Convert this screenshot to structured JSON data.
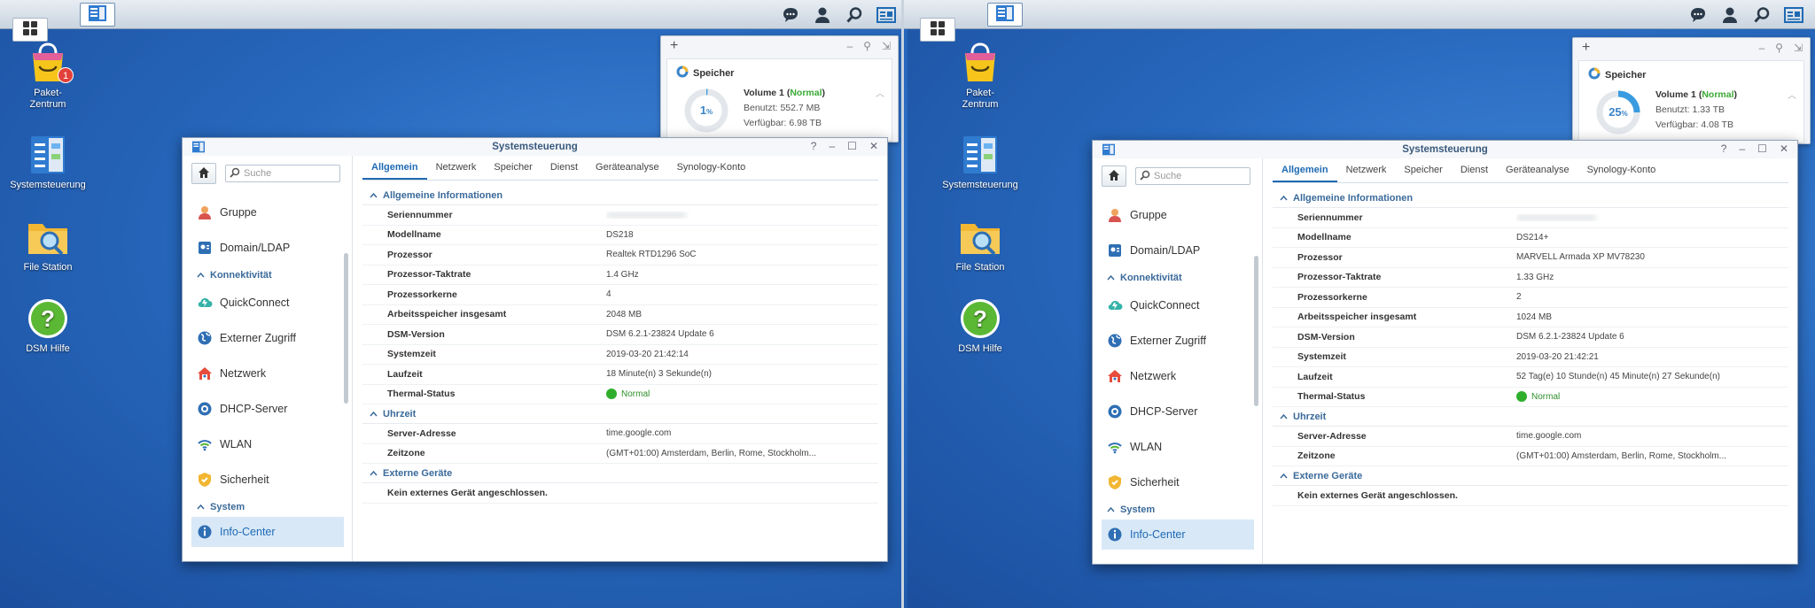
{
  "colors": {
    "accent": "#1f6ab4",
    "ok_green": "#2fae2c",
    "section_blue": "#3a6a9a",
    "desktop_blue": "#2768bd"
  },
  "desktop_icons": [
    {
      "label": "Paket-\nZentrum",
      "badge": "1",
      "icon": "package-center-icon"
    },
    {
      "label": "Systemsteuerung",
      "icon": "control-panel-icon"
    },
    {
      "label": "File Station",
      "icon": "file-station-icon"
    },
    {
      "label": "DSM Hilfe",
      "icon": "help-icon"
    }
  ],
  "taskbar": {
    "icons": [
      "chat-icon",
      "user-icon",
      "search-icon",
      "widgets-icon"
    ]
  },
  "left": {
    "widget": {
      "plus": "+",
      "title": "Speicher",
      "percent": "1",
      "percent_unit": "%",
      "percent_value": 1,
      "volume_name": "Volume 1 (",
      "volume_status": "Normal",
      "volume_close": ")",
      "used": "Benutzt: 552.7 MB",
      "free": "Verfügbar: 6.98 TB"
    },
    "window": {
      "title": "Systemsteuerung",
      "search_placeholder": "Suche",
      "nav": [
        {
          "type": "item",
          "label": "Gruppe",
          "icon": "group-icon"
        },
        {
          "type": "item",
          "label": "Domain/LDAP",
          "icon": "domain-icon"
        },
        {
          "type": "section",
          "label": "Konnektivität"
        },
        {
          "type": "item",
          "label": "QuickConnect",
          "icon": "quickconnect-icon"
        },
        {
          "type": "item",
          "label": "Externer Zugriff",
          "icon": "globe-icon"
        },
        {
          "type": "item",
          "label": "Netzwerk",
          "icon": "network-icon"
        },
        {
          "type": "item",
          "label": "DHCP-Server",
          "icon": "dhcp-icon"
        },
        {
          "type": "item",
          "label": "WLAN",
          "icon": "wifi-icon"
        },
        {
          "type": "item",
          "label": "Sicherheit",
          "icon": "shield-icon"
        },
        {
          "type": "section",
          "label": "System"
        },
        {
          "type": "item",
          "label": "Info-Center",
          "icon": "info-icon",
          "active": true
        }
      ],
      "tabs": [
        "Allgemein",
        "Netzwerk",
        "Speicher",
        "Dienst",
        "Geräteanalyse",
        "Synology-Konto"
      ],
      "sections": [
        {
          "title": "Allgemeine Informationen",
          "rows": [
            {
              "k": "Seriennummer",
              "v": "",
              "hidden": true
            },
            {
              "k": "Modellname",
              "v": "DS218"
            },
            {
              "k": "Prozessor",
              "v": "Realtek RTD1296 SoC"
            },
            {
              "k": "Prozessor-Taktrate",
              "v": "1.4 GHz"
            },
            {
              "k": "Prozessorkerne",
              "v": "4"
            },
            {
              "k": "Arbeitsspeicher insgesamt",
              "v": "2048 MB"
            },
            {
              "k": "DSM-Version",
              "v": "DSM 6.2.1-23824 Update 6"
            },
            {
              "k": "Systemzeit",
              "v": "2019-03-20 21:42:14"
            },
            {
              "k": "Laufzeit",
              "v": "18 Minute(n) 3 Sekunde(n)"
            },
            {
              "k": "Thermal-Status",
              "v": "Normal",
              "status": true
            }
          ]
        },
        {
          "title": "Uhrzeit",
          "rows": [
            {
              "k": "Server-Adresse",
              "v": "time.google.com"
            },
            {
              "k": "Zeitzone",
              "v": "(GMT+01:00) Amsterdam, Berlin, Rome, Stockholm..."
            }
          ]
        },
        {
          "title": "Externe Geräte",
          "rows": [
            {
              "k": "Kein externes Gerät angeschlossen.",
              "v": "",
              "full": true
            }
          ]
        }
      ]
    }
  },
  "right": {
    "widget": {
      "plus": "+",
      "title": "Speicher",
      "percent": "25",
      "percent_unit": "%",
      "percent_value": 25,
      "volume_name": "Volume 1 (",
      "volume_status": "Normal",
      "volume_close": ")",
      "used": "Benutzt: 1.33 TB",
      "free": "Verfügbar: 4.08 TB"
    },
    "window": {
      "title": "Systemsteuerung",
      "search_placeholder": "Suche",
      "nav": [
        {
          "type": "item",
          "label": "Gruppe",
          "icon": "group-icon"
        },
        {
          "type": "item",
          "label": "Domain/LDAP",
          "icon": "domain-icon"
        },
        {
          "type": "section",
          "label": "Konnektivität"
        },
        {
          "type": "item",
          "label": "QuickConnect",
          "icon": "quickconnect-icon"
        },
        {
          "type": "item",
          "label": "Externer Zugriff",
          "icon": "globe-icon"
        },
        {
          "type": "item",
          "label": "Netzwerk",
          "icon": "network-icon"
        },
        {
          "type": "item",
          "label": "DHCP-Server",
          "icon": "dhcp-icon"
        },
        {
          "type": "item",
          "label": "WLAN",
          "icon": "wifi-icon"
        },
        {
          "type": "item",
          "label": "Sicherheit",
          "icon": "shield-icon"
        },
        {
          "type": "section",
          "label": "System"
        },
        {
          "type": "item",
          "label": "Info-Center",
          "icon": "info-icon",
          "active": true
        }
      ],
      "tabs": [
        "Allgemein",
        "Netzwerk",
        "Speicher",
        "Dienst",
        "Geräteanalyse",
        "Synology-Konto"
      ],
      "sections": [
        {
          "title": "Allgemeine Informationen",
          "rows": [
            {
              "k": "Seriennummer",
              "v": "",
              "hidden": true
            },
            {
              "k": "Modellname",
              "v": "DS214+"
            },
            {
              "k": "Prozessor",
              "v": "MARVELL Armada XP MV78230"
            },
            {
              "k": "Prozessor-Taktrate",
              "v": "1.33 GHz"
            },
            {
              "k": "Prozessorkerne",
              "v": "2"
            },
            {
              "k": "Arbeitsspeicher insgesamt",
              "v": "1024 MB"
            },
            {
              "k": "DSM-Version",
              "v": "DSM 6.2.1-23824 Update 6"
            },
            {
              "k": "Systemzeit",
              "v": "2019-03-20 21:42:21"
            },
            {
              "k": "Laufzeit",
              "v": "52 Tag(e) 10 Stunde(n) 45 Minute(n) 27 Sekunde(n)"
            },
            {
              "k": "Thermal-Status",
              "v": "Normal",
              "status": true
            }
          ]
        },
        {
          "title": "Uhrzeit",
          "rows": [
            {
              "k": "Server-Adresse",
              "v": "time.google.com"
            },
            {
              "k": "Zeitzone",
              "v": "(GMT+01:00) Amsterdam, Berlin, Rome, Stockholm..."
            }
          ]
        },
        {
          "title": "Externe Geräte",
          "rows": [
            {
              "k": "Kein externes Gerät angeschlossen.",
              "v": "",
              "full": true
            }
          ]
        }
      ]
    }
  }
}
